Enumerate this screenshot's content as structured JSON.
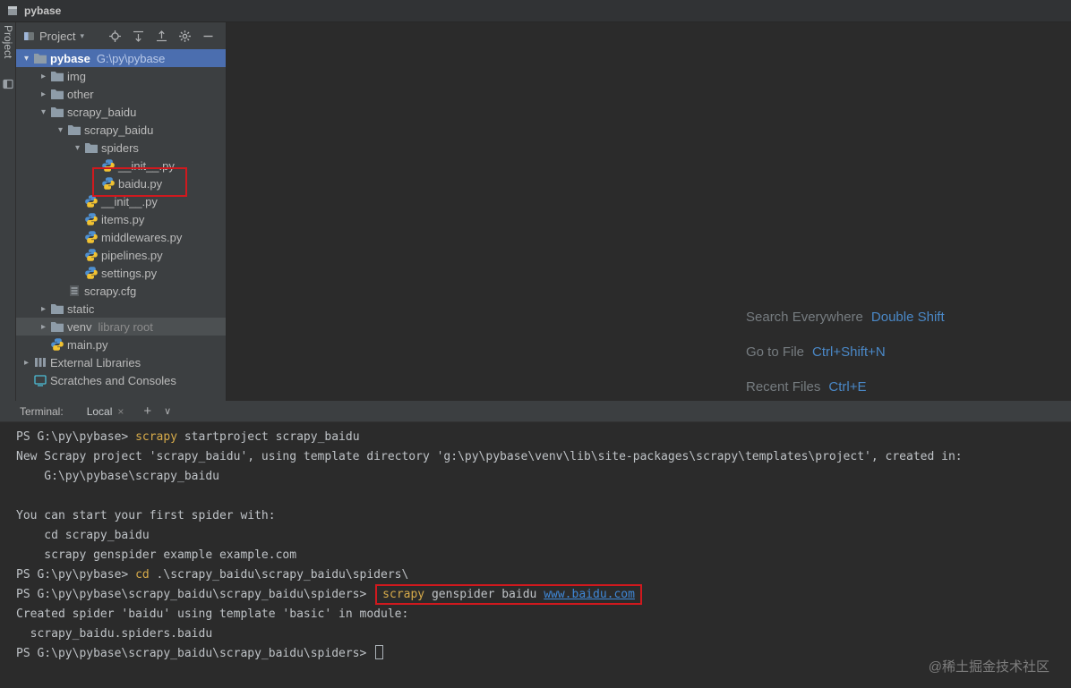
{
  "title_bar": {
    "title": "pybase"
  },
  "left_strip": {
    "label": "Project"
  },
  "icons": {
    "chevron_down": "▾",
    "chevron_right": "▸",
    "close": "×",
    "new": "+",
    "dropdown": "∨"
  },
  "colors": {
    "selection_blue": "#4b6eaf",
    "selection_inactive": "#4c5052",
    "annotation_red": "#d0191e",
    "link_blue": "#3f87d7",
    "command_yellow": "#d7ab4a",
    "shortcut_key_blue": "#4a88c7",
    "terminal_text": "#bfc3c7"
  },
  "project_panel": {
    "toolbar": {
      "selector_label": "Project",
      "icons": [
        "locate",
        "expand-all",
        "collapse-all",
        "settings",
        "hide"
      ]
    },
    "tree": [
      {
        "label": "pybase",
        "hint": "G:\\py\\pybase",
        "indent": 0,
        "chevron": "down",
        "icon": "folder",
        "selected": "active",
        "bold": true
      },
      {
        "label": "img",
        "indent": 1,
        "chevron": "right",
        "icon": "folder"
      },
      {
        "label": "other",
        "indent": 1,
        "chevron": "right",
        "icon": "folder"
      },
      {
        "label": "scrapy_baidu",
        "indent": 1,
        "chevron": "down",
        "icon": "folder"
      },
      {
        "label": "scrapy_baidu",
        "indent": 2,
        "chevron": "down",
        "icon": "folder"
      },
      {
        "label": "spiders",
        "indent": 3,
        "chevron": "down",
        "icon": "folder"
      },
      {
        "label": "__init__.py",
        "indent": 4,
        "icon": "python"
      },
      {
        "label": "baidu.py",
        "indent": 4,
        "icon": "python"
      },
      {
        "label": "__init__.py",
        "indent": 3,
        "icon": "python"
      },
      {
        "label": "items.py",
        "indent": 3,
        "icon": "python"
      },
      {
        "label": "middlewares.py",
        "indent": 3,
        "icon": "python"
      },
      {
        "label": "pipelines.py",
        "indent": 3,
        "icon": "python"
      },
      {
        "label": "settings.py",
        "indent": 3,
        "icon": "python"
      },
      {
        "label": "scrapy.cfg",
        "indent": 2,
        "icon": "config"
      },
      {
        "label": "static",
        "indent": 1,
        "chevron": "right",
        "icon": "folder"
      },
      {
        "label": "venv",
        "hint": "library root",
        "indent": 1,
        "chevron": "right",
        "icon": "folder",
        "selected": "inactive"
      },
      {
        "label": "main.py",
        "indent": 1,
        "icon": "python"
      },
      {
        "label": "External Libraries",
        "indent": 0,
        "chevron": "right",
        "icon": "library"
      },
      {
        "label": "Scratches and Consoles",
        "indent": 0,
        "icon": "scratches"
      }
    ]
  },
  "editor": {
    "shortcuts": [
      {
        "label": "Search Everywhere",
        "keys": "Double Shift"
      },
      {
        "label": "Go to File",
        "keys": "Ctrl+Shift+N"
      },
      {
        "label": "Recent Files",
        "keys": "Ctrl+E"
      }
    ]
  },
  "terminal": {
    "label": "Terminal:",
    "tab": "Local",
    "lines": [
      {
        "segments": [
          {
            "text": "PS G:\\py\\pybase> ",
            "style": "plain"
          },
          {
            "text": "scrapy",
            "style": "command"
          },
          {
            "text": " startproject scrapy_baidu",
            "style": "plain"
          }
        ]
      },
      {
        "segments": [
          {
            "text": "New Scrapy project 'scrapy_baidu', using template directory 'g:\\py\\pybase\\venv\\lib\\site-packages\\scrapy\\templates\\project', created in:",
            "style": "plain"
          }
        ]
      },
      {
        "segments": [
          {
            "text": "    G:\\py\\pybase\\scrapy_baidu",
            "style": "plain"
          }
        ]
      },
      {
        "segments": []
      },
      {
        "segments": [
          {
            "text": "You can start your first spider with:",
            "style": "plain"
          }
        ]
      },
      {
        "segments": [
          {
            "text": "    cd scrapy_baidu",
            "style": "plain"
          }
        ]
      },
      {
        "segments": [
          {
            "text": "    scrapy genspider example example.com",
            "style": "plain"
          }
        ]
      },
      {
        "segments": [
          {
            "text": "PS G:\\py\\pybase> ",
            "style": "plain"
          },
          {
            "text": "cd",
            "style": "command"
          },
          {
            "text": " .\\scrapy_baidu\\scrapy_baidu\\spiders\\",
            "style": "plain"
          }
        ]
      },
      {
        "segments": [
          {
            "text": "PS G:\\py\\pybase\\scrapy_baidu\\scrapy_baidu\\spiders> ",
            "style": "plain"
          },
          {
            "text": "scrapy",
            "style": "command"
          },
          {
            "text": " genspider baidu ",
            "style": "plain"
          },
          {
            "text": "www.baidu.com",
            "style": "link"
          }
        ],
        "box_from": 1,
        "box_to": 3
      },
      {
        "segments": [
          {
            "text": "Created spider 'baidu' using template 'basic' in module:",
            "style": "plain"
          }
        ]
      },
      {
        "segments": [
          {
            "text": "  scrapy_baidu.spiders.baidu",
            "style": "plain"
          }
        ]
      },
      {
        "segments": [
          {
            "text": "PS G:\\py\\pybase\\scrapy_baidu\\scrapy_baidu\\spiders> ",
            "style": "plain"
          }
        ],
        "cursor": true
      }
    ]
  },
  "watermark": "@稀土掘金技术社区"
}
